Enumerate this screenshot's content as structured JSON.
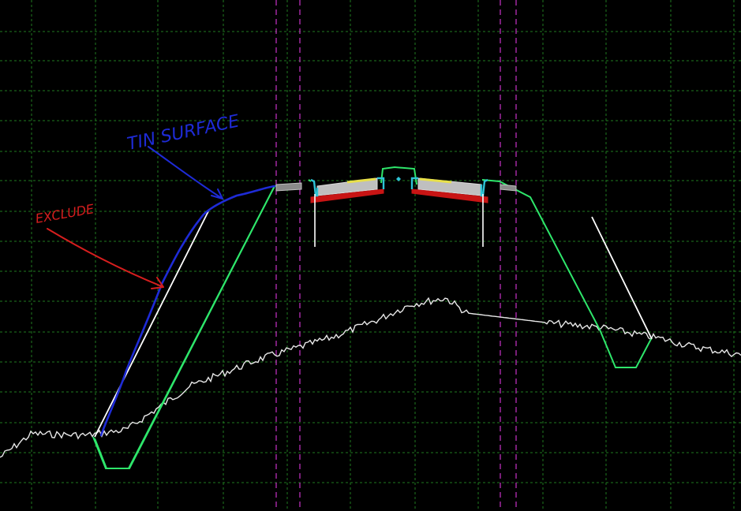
{
  "viewport": {
    "background": "#000000",
    "grid_color": "#1f7a1f",
    "guide_color": "#c832c8"
  },
  "annotations": {
    "tin_surface": {
      "text": "TIN SURFACE",
      "color": "#1e2bd6"
    },
    "exclude": {
      "text": "EXCLUDE",
      "color": "#d61e1e"
    }
  },
  "linework": {
    "template_color": "#2ee66b",
    "ground_color": "#e8e8e8",
    "pavement_color": "#bfbfbf",
    "subbase_color": "#c81414",
    "surface_color": "#e8e04a",
    "curb_color": "#2ec4d6",
    "tin_line_color": "#1e2bd6",
    "exclude_line_color": "#ffffff"
  }
}
